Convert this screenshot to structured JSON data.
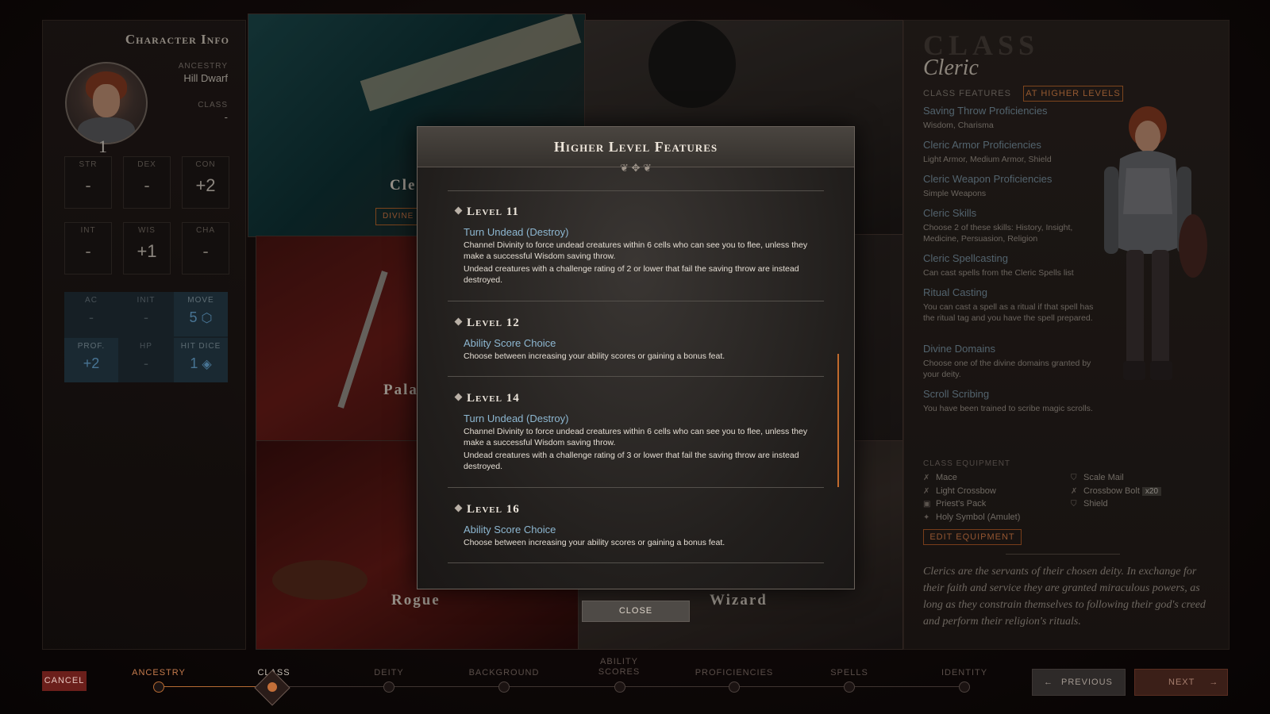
{
  "character": {
    "title": "Character Info",
    "level": "1",
    "ancestry_label": "ANCESTRY",
    "ancestry": "Hill Dwarf",
    "class_label": "CLASS",
    "class_value": "-",
    "abilities": [
      {
        "label": "STR",
        "value": "-"
      },
      {
        "label": "DEX",
        "value": "-"
      },
      {
        "label": "CON",
        "value": "+2"
      },
      {
        "label": "INT",
        "value": "-"
      },
      {
        "label": "WIS",
        "value": "+1"
      },
      {
        "label": "CHA",
        "value": "-"
      }
    ],
    "derived": [
      {
        "label": "AC",
        "value": "-"
      },
      {
        "label": "INIT",
        "value": "-"
      },
      {
        "label": "MOVE",
        "value": "5"
      },
      {
        "label": "PROF.",
        "value": "+2"
      },
      {
        "label": "HP",
        "value": "-"
      },
      {
        "label": "HIT DICE",
        "value": "1"
      }
    ]
  },
  "class_tiles": {
    "cleric": "Cle",
    "cleric_badge": "DIVINE D",
    "paladin": "Pala",
    "rogue": "Rogue",
    "wizard": "Wizard"
  },
  "class_panel": {
    "heading": "CLASS",
    "name": "Cleric",
    "tab_features": "CLASS FEATURES",
    "tab_higher": "AT HIGHER LEVELS",
    "features": [
      {
        "title": "Saving Throw Proficiencies",
        "desc": "Wisdom, Charisma"
      },
      {
        "title": "Cleric Armor Proficiencies",
        "desc": "Light Armor, Medium Armor, Shield"
      },
      {
        "title": "Cleric Weapon Proficiencies",
        "desc": "Simple Weapons"
      },
      {
        "title": "Cleric Skills",
        "desc": "Choose 2 of these skills: History, Insight, Medicine, Persuasion, Religion"
      },
      {
        "title": "Cleric Spellcasting",
        "desc": "Can cast spells from the Cleric Spells list"
      },
      {
        "title": "Ritual Casting",
        "desc": "You can cast a spell as a ritual if that spell has the ritual tag and you have the spell prepared."
      },
      {
        "title": "Divine Domains",
        "desc": "Choose one of the divine domains granted by your deity."
      },
      {
        "title": "Scroll Scribing",
        "desc": "You have been trained to scribe magic scrolls."
      }
    ],
    "equipment_label": "CLASS EQUIPMENT",
    "equipment": [
      {
        "name": "Mace",
        "icon": "sword-icon"
      },
      {
        "name": "Light Crossbow",
        "icon": "sword-icon"
      },
      {
        "name": "Priest's Pack",
        "icon": "pack-icon"
      },
      {
        "name": "Holy Symbol (Amulet)",
        "icon": "sparkle-icon"
      },
      {
        "name": "Scale Mail",
        "icon": "shield-icon"
      },
      {
        "name": "Crossbow Bolt",
        "icon": "sword-icon",
        "qty": "x20"
      },
      {
        "name": "Shield",
        "icon": "shield-icon"
      }
    ],
    "edit_equipment": "EDIT EQUIPMENT",
    "blurb": "Clerics are the servants of their chosen deity. In exchange for their faith and service they are granted miraculous powers, as long as they constrain themselves to following their god's creed and perform their religion's rituals."
  },
  "modal": {
    "title": "Higher Level Features",
    "levels": [
      {
        "level": "Level 11",
        "feature": "Turn Undead (Destroy)",
        "desc1": "Channel Divinity to force undead creatures within 6 cells who can see you to flee, unless they make a successful Wisdom saving throw.",
        "desc2": "Undead creatures with a challenge rating of 2 or lower that fail the saving throw are instead destroyed."
      },
      {
        "level": "Level 12",
        "feature": "Ability Score Choice",
        "desc1": "Choose between increasing your ability scores or gaining a bonus feat."
      },
      {
        "level": "Level 14",
        "feature": "Turn Undead (Destroy)",
        "desc1": "Channel Divinity to force undead creatures within 6 cells who can see you to flee, unless they make a successful Wisdom saving throw.",
        "desc2": "Undead creatures with a challenge rating of 3 or lower that fail the saving throw are instead destroyed."
      },
      {
        "level": "Level 16",
        "feature": "Ability Score Choice",
        "desc1": "Choose between increasing your ability scores or gaining a bonus feat."
      }
    ],
    "close": "CLOSE"
  },
  "footer": {
    "cancel": "CANCEL",
    "steps": [
      "ANCESTRY",
      "CLASS",
      "DEITY",
      "BACKGROUND",
      "ABILITY SCORES",
      "PROFICIENCIES",
      "SPELLS",
      "IDENTITY"
    ],
    "previous": "PREVIOUS",
    "next": "NEXT"
  },
  "colors": {
    "accent_orange": "#c06a2d",
    "feature_blue": "#8db7d1",
    "stat_blue": "#6fb2e3",
    "cancel_red": "#6b1f1b"
  }
}
